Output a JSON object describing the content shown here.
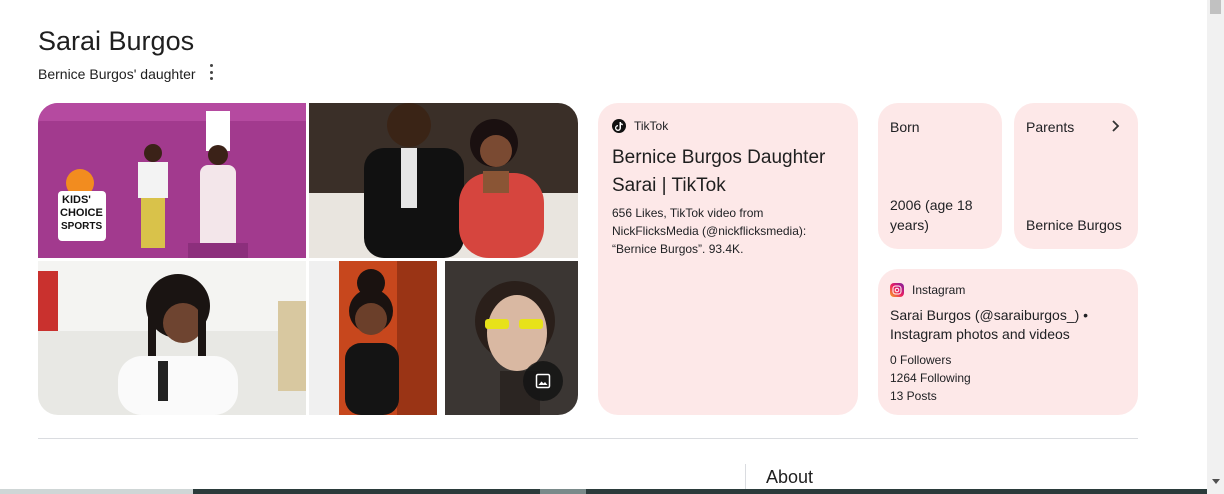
{
  "entity": {
    "title": "Sarai Burgos",
    "subtitle": "Bernice Burgos' daughter"
  },
  "gallery": {
    "images": [
      {
        "name": "kids-choice-sports-photo"
      },
      {
        "name": "couple-photo"
      },
      {
        "name": "braids-photo"
      },
      {
        "name": "car-seat-photo"
      },
      {
        "name": "yellow-glasses-photo"
      }
    ],
    "kca_text": [
      "KIDS'",
      "CHOICE",
      "SPORTS"
    ]
  },
  "tiktok": {
    "source": "TikTok",
    "headline": "Bernice Burgos Daughter Sarai | TikTok",
    "description": "656 Likes, TikTok video from NickFlicksMedia (@nickflicksmedia): “Bernice Burgos”. 93.4K."
  },
  "facts": {
    "born": {
      "label": "Born",
      "value": "2006 (age 18 years)"
    },
    "parents": {
      "label": "Parents",
      "value": "Bernice Burgos"
    }
  },
  "instagram": {
    "source": "Instagram",
    "headline": "Sarai Burgos (@saraiburgos_) • Instagram photos and videos",
    "followers": "0 Followers",
    "following": "1264 Following",
    "posts": "13 Posts"
  },
  "about": {
    "heading": "About"
  },
  "colors": {
    "card_bg": "#fde8e8",
    "text": "#1f1f1f"
  },
  "icons": [
    "more-vert-icon",
    "image-icon",
    "tiktok-icon",
    "chevron-right-icon",
    "instagram-icon"
  ]
}
